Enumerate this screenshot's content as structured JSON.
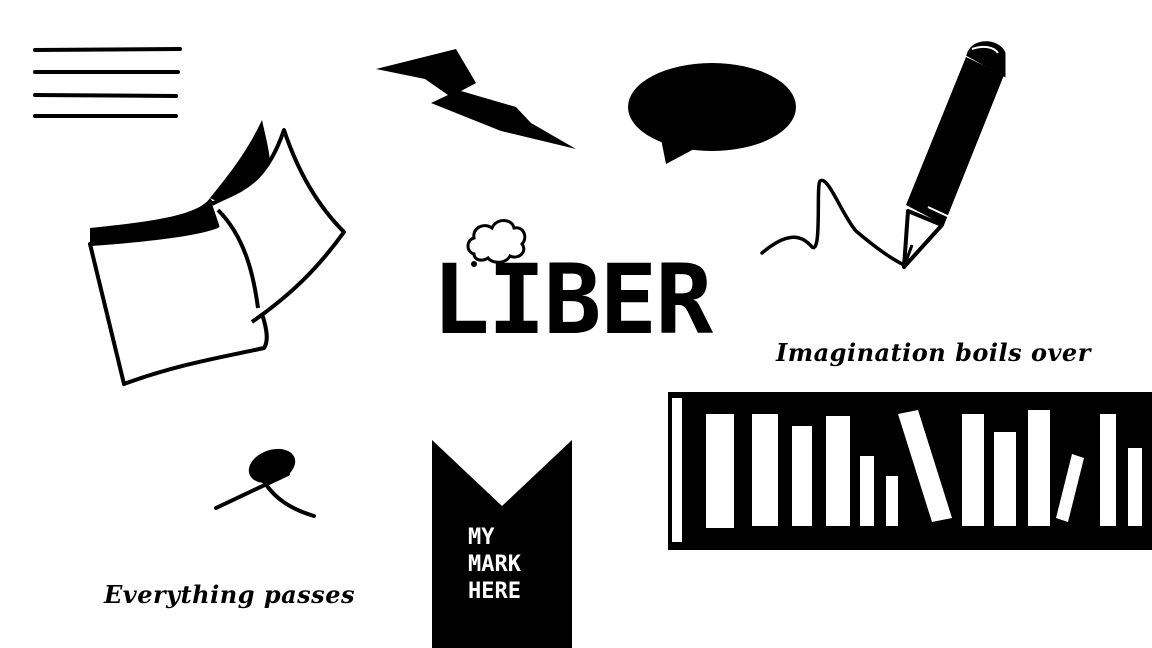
{
  "colors": {
    "ink": "#000000",
    "paper": "#ffffff"
  },
  "logo": {
    "text": "LIBER"
  },
  "taglines": {
    "imagination": "Imagination boils over",
    "passes": "Everything passes"
  },
  "bookmark": {
    "text": "MY\nMARK\nHERE"
  },
  "icons": [
    "menu-lines-icon",
    "lightning-bolt-icon",
    "speech-bubble-icon",
    "pencil-icon",
    "open-book-icon",
    "thought-cloud-icon",
    "ribbon-icon",
    "bookshelf-icon"
  ]
}
